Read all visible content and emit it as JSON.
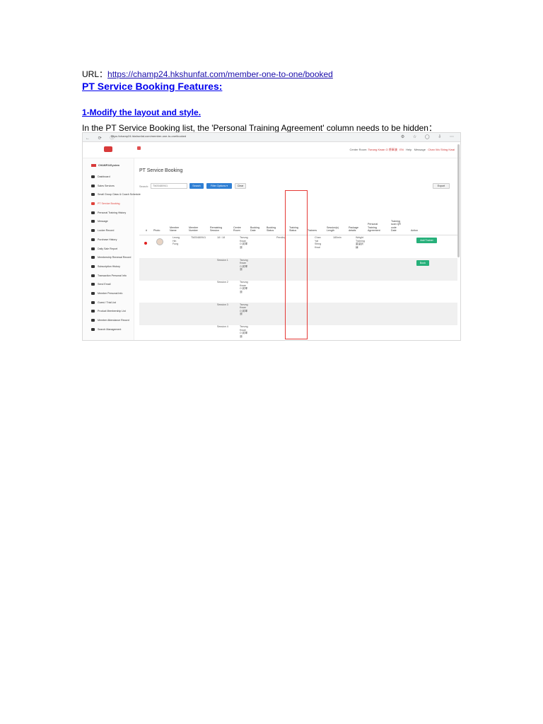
{
  "doc": {
    "url_prefix": "URL：",
    "url": "https://champ24.hkshunfat.com/member-one-to-one/booked",
    "heading": "PT Service Booking Features:",
    "subheading": "1-Modify the layout and style.",
    "paragraph": "In the PT Service Booking list, the 'Personal Training Agreement' column needs to be hidden："
  },
  "screenshot": {
    "browser": {
      "nav_icons": "← ⟳ ⓘ",
      "address": "https://champ24.hkshunfat.com/member-one-to-one/booked",
      "tools": "⚙ ☆ ◯ ⇩ ⋯"
    },
    "topbar": {
      "center_label": "Center Room:",
      "center_value": "Tseung Kwan O 將軍澳",
      "lang": "EN",
      "help": "Help",
      "message": "Message",
      "user": "Chan Wu Shing Kwai"
    },
    "sidebar": {
      "brand": "CHAMP24System",
      "items": [
        {
          "label": "Dashboard",
          "active": false
        },
        {
          "label": "Sales Services",
          "active": false
        },
        {
          "label": "Small Group Class & Coach Schedule",
          "active": false
        },
        {
          "label": "PT Service Booking",
          "active": true
        },
        {
          "label": "Personal Training History",
          "active": false
        },
        {
          "label": "Message",
          "active": false
        },
        {
          "label": "Locker Record",
          "active": false
        },
        {
          "label": "Purchase History",
          "active": false
        },
        {
          "label": "Daily Sale Report",
          "active": false
        },
        {
          "label": "Membership Renewal Record",
          "active": false
        },
        {
          "label": "Subscription History",
          "active": false
        },
        {
          "label": "Transaction Personal Info",
          "active": false
        },
        {
          "label": "Send Email",
          "active": false
        },
        {
          "label": "Member Personal Info",
          "active": false
        },
        {
          "label": "Guest / Trial List",
          "active": false
        },
        {
          "label": "Product Membership List",
          "active": false
        },
        {
          "label": "Member Attendance Record",
          "active": false
        },
        {
          "label": "Search Management",
          "active": false
        }
      ]
    },
    "main": {
      "title": "PT Service Booking",
      "search_label": "Search:",
      "search_value": "TM20480941",
      "search_btn": "Search",
      "filter_btn": "Filter Options ▾",
      "clear_btn": "Clear",
      "export_btn": "Export",
      "columns": [
        "#",
        "Photo",
        "Member\nName",
        "Member\nNumber",
        "Remaining\nSession",
        "Centre\nRoom",
        "Booking\nDate",
        "Booking\nStatus",
        "Training\nStatus",
        "Trainers",
        "Session(s)\nLength",
        "Package\ndetails",
        "Personal\nTraining\nAgreement",
        "Training\nscan QR\ncode\nDate",
        "Action"
      ],
      "rows": [
        {
          "name": "Leung\nHin\nFung",
          "number": "TM20480941",
          "remaining": "18 / 18",
          "room": "Tseung\nKwan\nO 將軍\n澳",
          "status": "Pending",
          "trainer": "Chan\nYat\nShing\nKwai",
          "length": "180min",
          "package": "Weight\nTraining\n重量訓\n練",
          "action": "Add Trainer"
        },
        {
          "session": "Session 1",
          "room": "Tseung\nKwan\nO 將軍\n澳",
          "action": "Book"
        },
        {
          "session": "Session 2",
          "room": "Tseung\nKwan\nO 將軍\n澳"
        },
        {
          "session": "Session 3",
          "room": "Tseung\nKwan\nO 將軍\n澳"
        },
        {
          "session": "Session 4",
          "room": "Tseung\nKwan\nO 將軍\n澳"
        },
        {
          "session": "Session 4",
          "room": "Tseung\nKwan\nO 將軍\n澳"
        }
      ]
    }
  },
  "colors": {
    "link": "#0000ee",
    "highlight_box": "#e53935",
    "primary_button": "#2f7fd4",
    "success_button": "#26b07a"
  }
}
